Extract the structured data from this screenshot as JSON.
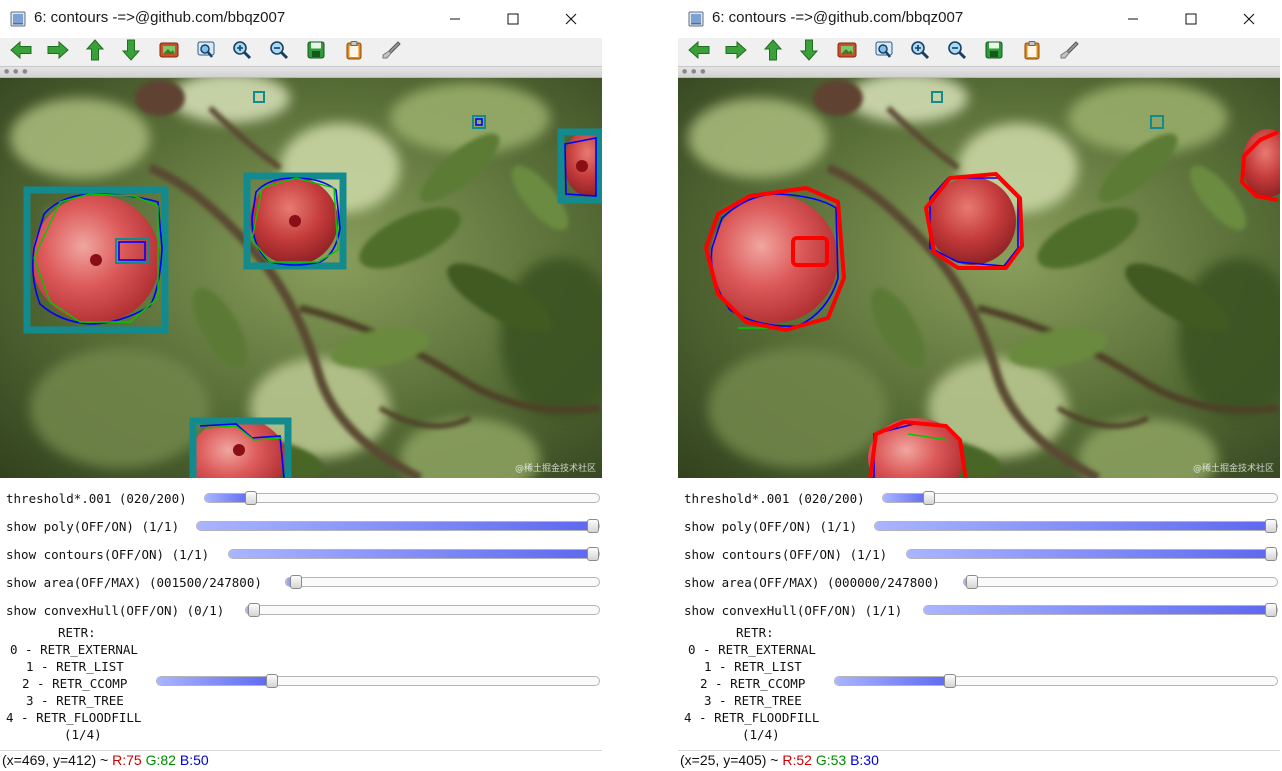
{
  "windows": [
    {
      "id": "left",
      "title": "6: contours -=>@github.com/bbqz007",
      "sliders": [
        {
          "label": "threshold*.001 (020/200)",
          "fraction": 0.1
        },
        {
          "label": "show poly(OFF/ON) (1/1)",
          "fraction": 1.0
        },
        {
          "label": "show contours(OFF/ON) (1/1)",
          "fraction": 1.0
        },
        {
          "label": "show area(OFF/MAX) (001500/247800)",
          "fraction": 0.006
        },
        {
          "label": "show convexHull(OFF/ON) (0/1)",
          "fraction": 0.0
        }
      ],
      "retr": {
        "heading": "RETR:",
        "options": [
          "0 - RETR_EXTERNAL",
          "1 - RETR_LIST",
          "2 - RETR_CCOMP",
          "3 - RETR_TREE",
          "4 - RETR_FLOODFILL"
        ],
        "value_text": "(1/4)",
        "fraction": 0.25
      },
      "status": {
        "coord": "(x=469, y=412) ~ ",
        "r": "R:75",
        "g": "G:82",
        "b": "B:50"
      },
      "watermark": "@稀土掘金技术社区"
    },
    {
      "id": "right",
      "title": "6: contours -=>@github.com/bbqz007",
      "sliders": [
        {
          "label": "threshold*.001 (020/200)",
          "fraction": 0.1
        },
        {
          "label": "show poly(OFF/ON) (1/1)",
          "fraction": 1.0
        },
        {
          "label": "show contours(OFF/ON) (1/1)",
          "fraction": 1.0
        },
        {
          "label": "show area(OFF/MAX) (000000/247800)",
          "fraction": 0.0
        },
        {
          "label": "show convexHull(OFF/ON) (1/1)",
          "fraction": 1.0
        }
      ],
      "retr": {
        "heading": "RETR:",
        "options": [
          "0 - RETR_EXTERNAL",
          "1 - RETR_LIST",
          "2 - RETR_CCOMP",
          "3 - RETR_TREE",
          "4 - RETR_FLOODFILL"
        ],
        "value_text": "(1/4)",
        "fraction": 0.25
      },
      "status": {
        "coord": "(x=25, y=405) ~ ",
        "r": "R:52",
        "g": "G:53",
        "b": "B:30"
      },
      "watermark": "@稀土掘金技术社区"
    }
  ],
  "toolbar_icons": [
    "arrow-left-icon",
    "arrow-right-icon",
    "arrow-up-icon",
    "arrow-down-icon",
    "image-icon",
    "zoom-fit-icon",
    "zoom-in-icon",
    "zoom-out-icon",
    "save-icon",
    "clipboard-icon",
    "brush-icon"
  ],
  "colors": {
    "fill_start": "#a9b5ff",
    "fill_end": "#5d68f0",
    "teal_box": "#138a8e",
    "red_hull": "#ff0000",
    "blue_contour": "#0000ff",
    "green_poly": "#00c800"
  }
}
